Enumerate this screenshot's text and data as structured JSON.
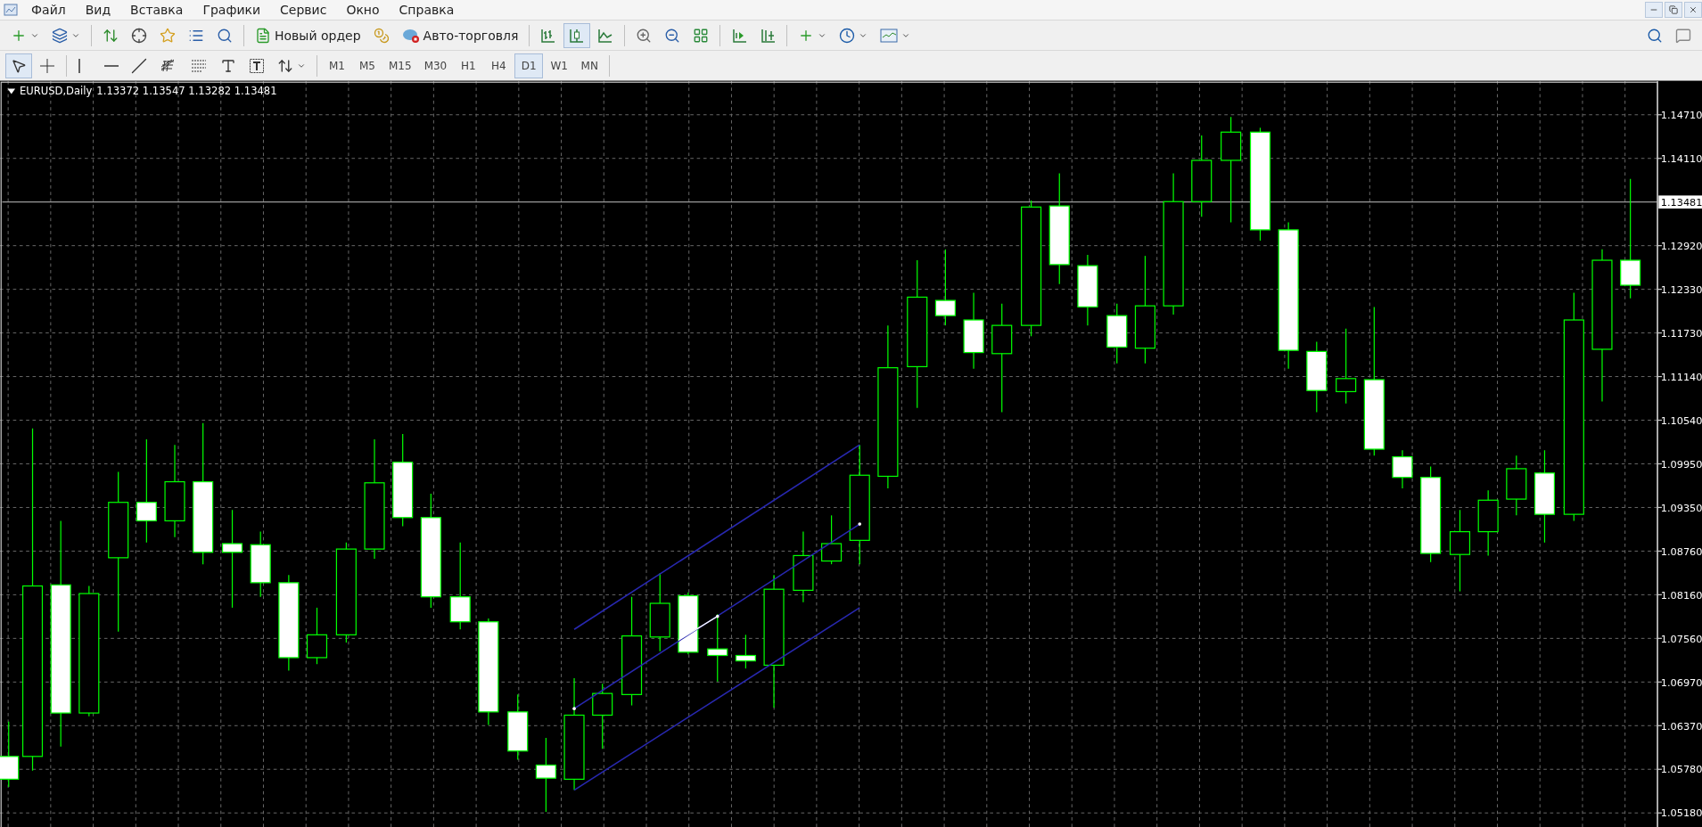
{
  "menu": [
    "Файл",
    "Вид",
    "Вставка",
    "Графики",
    "Сервис",
    "Окно",
    "Справка"
  ],
  "toolbar": {
    "order_button": "Новый ордер",
    "autotrading_button": "Авто-торговля",
    "chart_types": [
      {
        "kind": "bars",
        "selected": false
      },
      {
        "kind": "candles",
        "selected": true
      },
      {
        "kind": "line",
        "selected": false
      }
    ]
  },
  "drawing_tools": [
    {
      "kind": "cursor",
      "selected": true
    },
    {
      "kind": "crosshair",
      "selected": false
    },
    {
      "kind": "vline",
      "selected": false
    },
    {
      "kind": "hline",
      "selected": false
    },
    {
      "kind": "trendline",
      "selected": false
    },
    {
      "kind": "fibo-e",
      "selected": false
    },
    {
      "kind": "fibo-f",
      "selected": false
    },
    {
      "kind": "text",
      "selected": false
    },
    {
      "kind": "label",
      "selected": false
    },
    {
      "kind": "arrows",
      "selected": false
    }
  ],
  "timeframes": [
    {
      "label": "M1",
      "selected": false
    },
    {
      "label": "M5",
      "selected": false
    },
    {
      "label": "M15",
      "selected": false
    },
    {
      "label": "M30",
      "selected": false
    },
    {
      "label": "H1",
      "selected": false
    },
    {
      "label": "H4",
      "selected": false
    },
    {
      "label": "D1",
      "selected": true
    },
    {
      "label": "W1",
      "selected": false
    },
    {
      "label": "MN",
      "selected": false
    }
  ],
  "chart": {
    "symbol": "EURUSD,Daily",
    "ohlc": "1.13372 1.13547 1.13282 1.13481",
    "current_price": "1.13481",
    "price_ticks": [
      "1.14710",
      "1.14110",
      "1.12920",
      "1.12330",
      "1.11730",
      "1.11140",
      "1.10540",
      "1.09950",
      "1.09350",
      "1.08760",
      "1.08160",
      "1.07560",
      "1.06970",
      "1.06370",
      "1.05780",
      "1.05180"
    ]
  }
}
